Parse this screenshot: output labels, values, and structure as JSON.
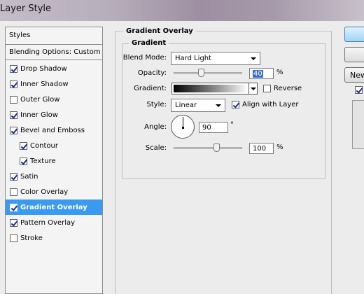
{
  "window": {
    "title": "Layer Style"
  },
  "styles": {
    "header": "Styles",
    "blending_options": "Blending Options: Custom",
    "items": [
      {
        "label": "Drop Shadow",
        "checked": true,
        "indent": false,
        "active": false
      },
      {
        "label": "Inner Shadow",
        "checked": true,
        "indent": false,
        "active": false
      },
      {
        "label": "Outer Glow",
        "checked": false,
        "indent": false,
        "active": false
      },
      {
        "label": "Inner Glow",
        "checked": true,
        "indent": false,
        "active": false
      },
      {
        "label": "Bevel and Emboss",
        "checked": true,
        "indent": false,
        "active": false
      },
      {
        "label": "Contour",
        "checked": true,
        "indent": true,
        "active": false
      },
      {
        "label": "Texture",
        "checked": true,
        "indent": true,
        "active": false
      },
      {
        "label": "Satin",
        "checked": true,
        "indent": false,
        "active": false
      },
      {
        "label": "Color Overlay",
        "checked": false,
        "indent": false,
        "active": false
      },
      {
        "label": "Gradient Overlay",
        "checked": true,
        "indent": false,
        "active": true
      },
      {
        "label": "Pattern Overlay",
        "checked": true,
        "indent": false,
        "active": false
      },
      {
        "label": "Stroke",
        "checked": false,
        "indent": false,
        "active": false
      }
    ]
  },
  "panel": {
    "title": "Gradient Overlay",
    "group_title": "Gradient",
    "blend_mode": {
      "label": "Blend Mode:",
      "value": "Hard Light"
    },
    "opacity": {
      "label": "Opacity:",
      "value": "40",
      "unit": "%",
      "level": 0.4
    },
    "gradient": {
      "label": "Gradient:",
      "reverse_label": "Reverse",
      "reverse_checked": false
    },
    "style": {
      "label": "Style:",
      "value": "Linear",
      "align_label": "Align with Layer",
      "align_checked": true
    },
    "angle": {
      "label": "Angle:",
      "value": "90",
      "unit": "°"
    },
    "scale": {
      "label": "Scale:",
      "value": "100",
      "unit": "%",
      "level": 0.62
    }
  },
  "buttons": {
    "new_style_label": "New"
  },
  "colors": {
    "selection": "#3a99f0",
    "title_gradient_mid": "#9d8fa1"
  }
}
